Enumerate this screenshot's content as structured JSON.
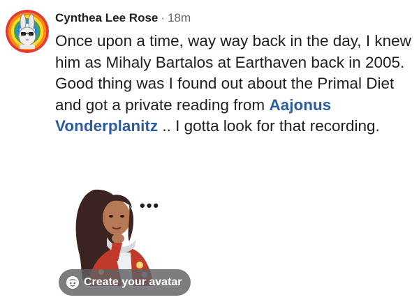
{
  "comment": {
    "author": "Cynthea Lee Rose",
    "separator": "·",
    "time": "18m",
    "text_part1": "Once upon a time, way way back in the day, I knew him as Mihaly Bartalos at Earthaven back in 2005.  Good thing was I found out about the Primal Diet and got a private reading from ",
    "mention": "Aajonus Vonderplanitz",
    "text_part2": " .. I gotta look for that recording."
  },
  "sticker": {
    "typing_dots": "•••",
    "button_label": "Create your avatar",
    "button_icon": "avatar-face-icon"
  },
  "colors": {
    "mention": "#2d5c9e",
    "muted": "#65676b",
    "text": "#1c1e21"
  }
}
